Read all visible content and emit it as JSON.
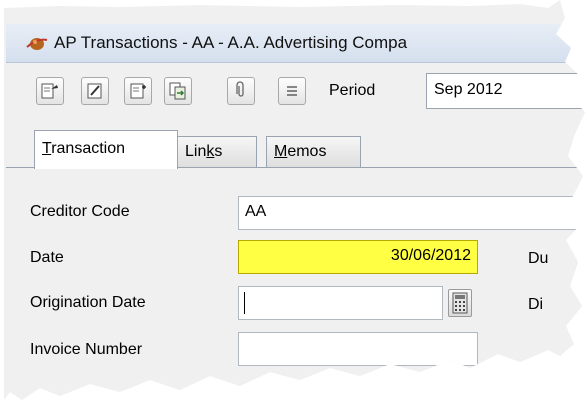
{
  "window": {
    "title": "AP Transactions - AA - A.A. Advertising Compa"
  },
  "toolbar": {
    "buttons": [
      {
        "icon": "lookup-icon"
      },
      {
        "icon": "edit-icon"
      },
      {
        "icon": "new-icon"
      },
      {
        "icon": "copy-icon"
      },
      {
        "icon": "attachment-icon"
      },
      {
        "icon": "list-icon"
      }
    ],
    "period_label": "Period",
    "period_value": "Sep 2012"
  },
  "tabs": [
    {
      "pre": "",
      "ul": "T",
      "post": "ransaction"
    },
    {
      "pre": "Lin",
      "ul": "k",
      "post": "s"
    },
    {
      "pre": "",
      "ul": "M",
      "post": "emos"
    }
  ],
  "form": {
    "creditor_code_label": "Creditor Code",
    "creditor_code_value": "AA",
    "date_label": "Date",
    "date_value": "30/06/2012",
    "origination_date_label": "Origination Date",
    "origination_date_value": "",
    "invoice_number_label": "Invoice Number",
    "invoice_number_value": "",
    "due_label_partial": "Du",
    "di_label_partial": "Di"
  },
  "colors": {
    "date_highlight": "#ffff44",
    "titlebar": "#d4dfee"
  }
}
